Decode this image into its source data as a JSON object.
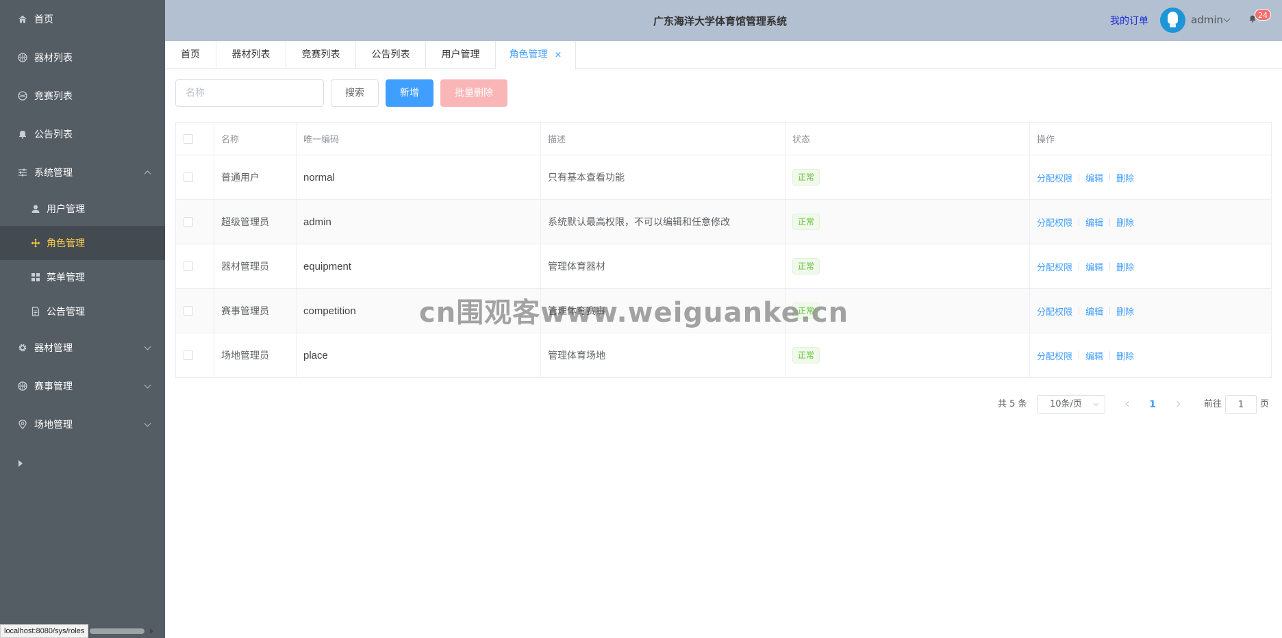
{
  "sidebar": {
    "items": [
      {
        "label": "首页",
        "icon": "home-icon"
      },
      {
        "label": "器材列表",
        "icon": "basketball-icon"
      },
      {
        "label": "竞赛列表",
        "icon": "ball-icon"
      },
      {
        "label": "公告列表",
        "icon": "bell-icon"
      },
      {
        "label": "系统管理",
        "icon": "sliders-icon",
        "expanded": true
      },
      {
        "label": "器材管理",
        "icon": "gear-icon"
      },
      {
        "label": "赛事管理",
        "icon": "basketball-icon"
      },
      {
        "label": "场地管理",
        "icon": "location-icon"
      }
    ],
    "submenu": [
      {
        "label": "用户管理",
        "icon": "user-icon"
      },
      {
        "label": "角色管理",
        "icon": "move-icon",
        "active": true
      },
      {
        "label": "菜单管理",
        "icon": "grid-icon"
      },
      {
        "label": "公告管理",
        "icon": "document-icon"
      }
    ]
  },
  "header": {
    "title": "广东海洋大学体育馆管理系统",
    "my_orders": "我的订单",
    "username": "admin",
    "badge_count": "24"
  },
  "tabs": [
    {
      "label": "首页"
    },
    {
      "label": "器材列表"
    },
    {
      "label": "竞赛列表"
    },
    {
      "label": "公告列表"
    },
    {
      "label": "用户管理"
    },
    {
      "label": "角色管理",
      "active": true,
      "close": "×"
    }
  ],
  "toolbar": {
    "search_placeholder": "名称",
    "search_label": "搜索",
    "add_label": "新增",
    "batch_delete_label": "批量删除"
  },
  "table": {
    "headers": [
      "名称",
      "唯一编码",
      "描述",
      "状态",
      "操作"
    ],
    "rows": [
      {
        "name": "普通用户",
        "code": "normal",
        "description": "只有基本查看功能",
        "status": "正常"
      },
      {
        "name": "超级管理员",
        "code": "admin",
        "description": "系统默认最高权限，不可以编辑和任意修改",
        "status": "正常"
      },
      {
        "name": "器材管理员",
        "code": "equipment",
        "description": "管理体育器材",
        "status": "正常"
      },
      {
        "name": "赛事管理员",
        "code": "competition",
        "description": "管理体育赛事",
        "status": "正常"
      },
      {
        "name": "场地管理员",
        "code": "place",
        "description": "管理体育场地",
        "status": "正常"
      }
    ],
    "actions": {
      "assign": "分配权限",
      "edit": "编辑",
      "delete": "删除"
    }
  },
  "pagination": {
    "total": "共 5 条",
    "page_size": "10条/页",
    "current_page": "1",
    "goto_label": "前往",
    "goto_value": "1",
    "page_suffix": "页"
  },
  "statusbar": {
    "url": "localhost:8080/sys/roles"
  },
  "watermark": "cn围观客www.weiguanke.cn",
  "colors": {
    "sidebar_bg": "#545c64",
    "active_menu": "#ffd04b",
    "header_bg": "#b3c0d1",
    "primary": "#409eff",
    "danger_light": "#fab6b6",
    "success": "#67c23a"
  }
}
